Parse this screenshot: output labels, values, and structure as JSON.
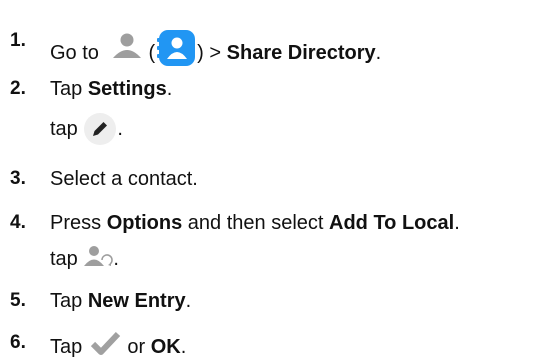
{
  "steps": [
    {
      "num": "1.",
      "pre": "Go to",
      "paren_open": "(",
      "paren_close": ")",
      "sep": ">",
      "bold": "Share Directory",
      "end": "."
    },
    {
      "num": "2.",
      "pre": "Tap",
      "bold": "Settings",
      "end": ".",
      "sub_text": "tap",
      "sub_end": "."
    },
    {
      "num": "3.",
      "text": "Select a contact."
    },
    {
      "num": "4.",
      "pre": "Press",
      "bold1": "Options",
      "mid": "and then select",
      "bold2": "Add To Local",
      "end": ".",
      "sub_text": "tap",
      "sub_end": "."
    },
    {
      "num": "5.",
      "pre": "Tap",
      "bold": "New Entry",
      "end": "."
    },
    {
      "num": "6.",
      "pre": "Tap",
      "mid": "or",
      "bold": "OK",
      "end": "."
    }
  ],
  "icons": {
    "contacts": "person-icon",
    "contacts_app": "contacts-app-icon",
    "edit": "pencil-icon",
    "add_local": "person-sync-icon",
    "confirm": "checkmark-icon"
  },
  "colors": {
    "app_icon_blue": "#2196f3",
    "gray_icon": "#9e9e9e",
    "light_circle": "#eeeeee"
  }
}
